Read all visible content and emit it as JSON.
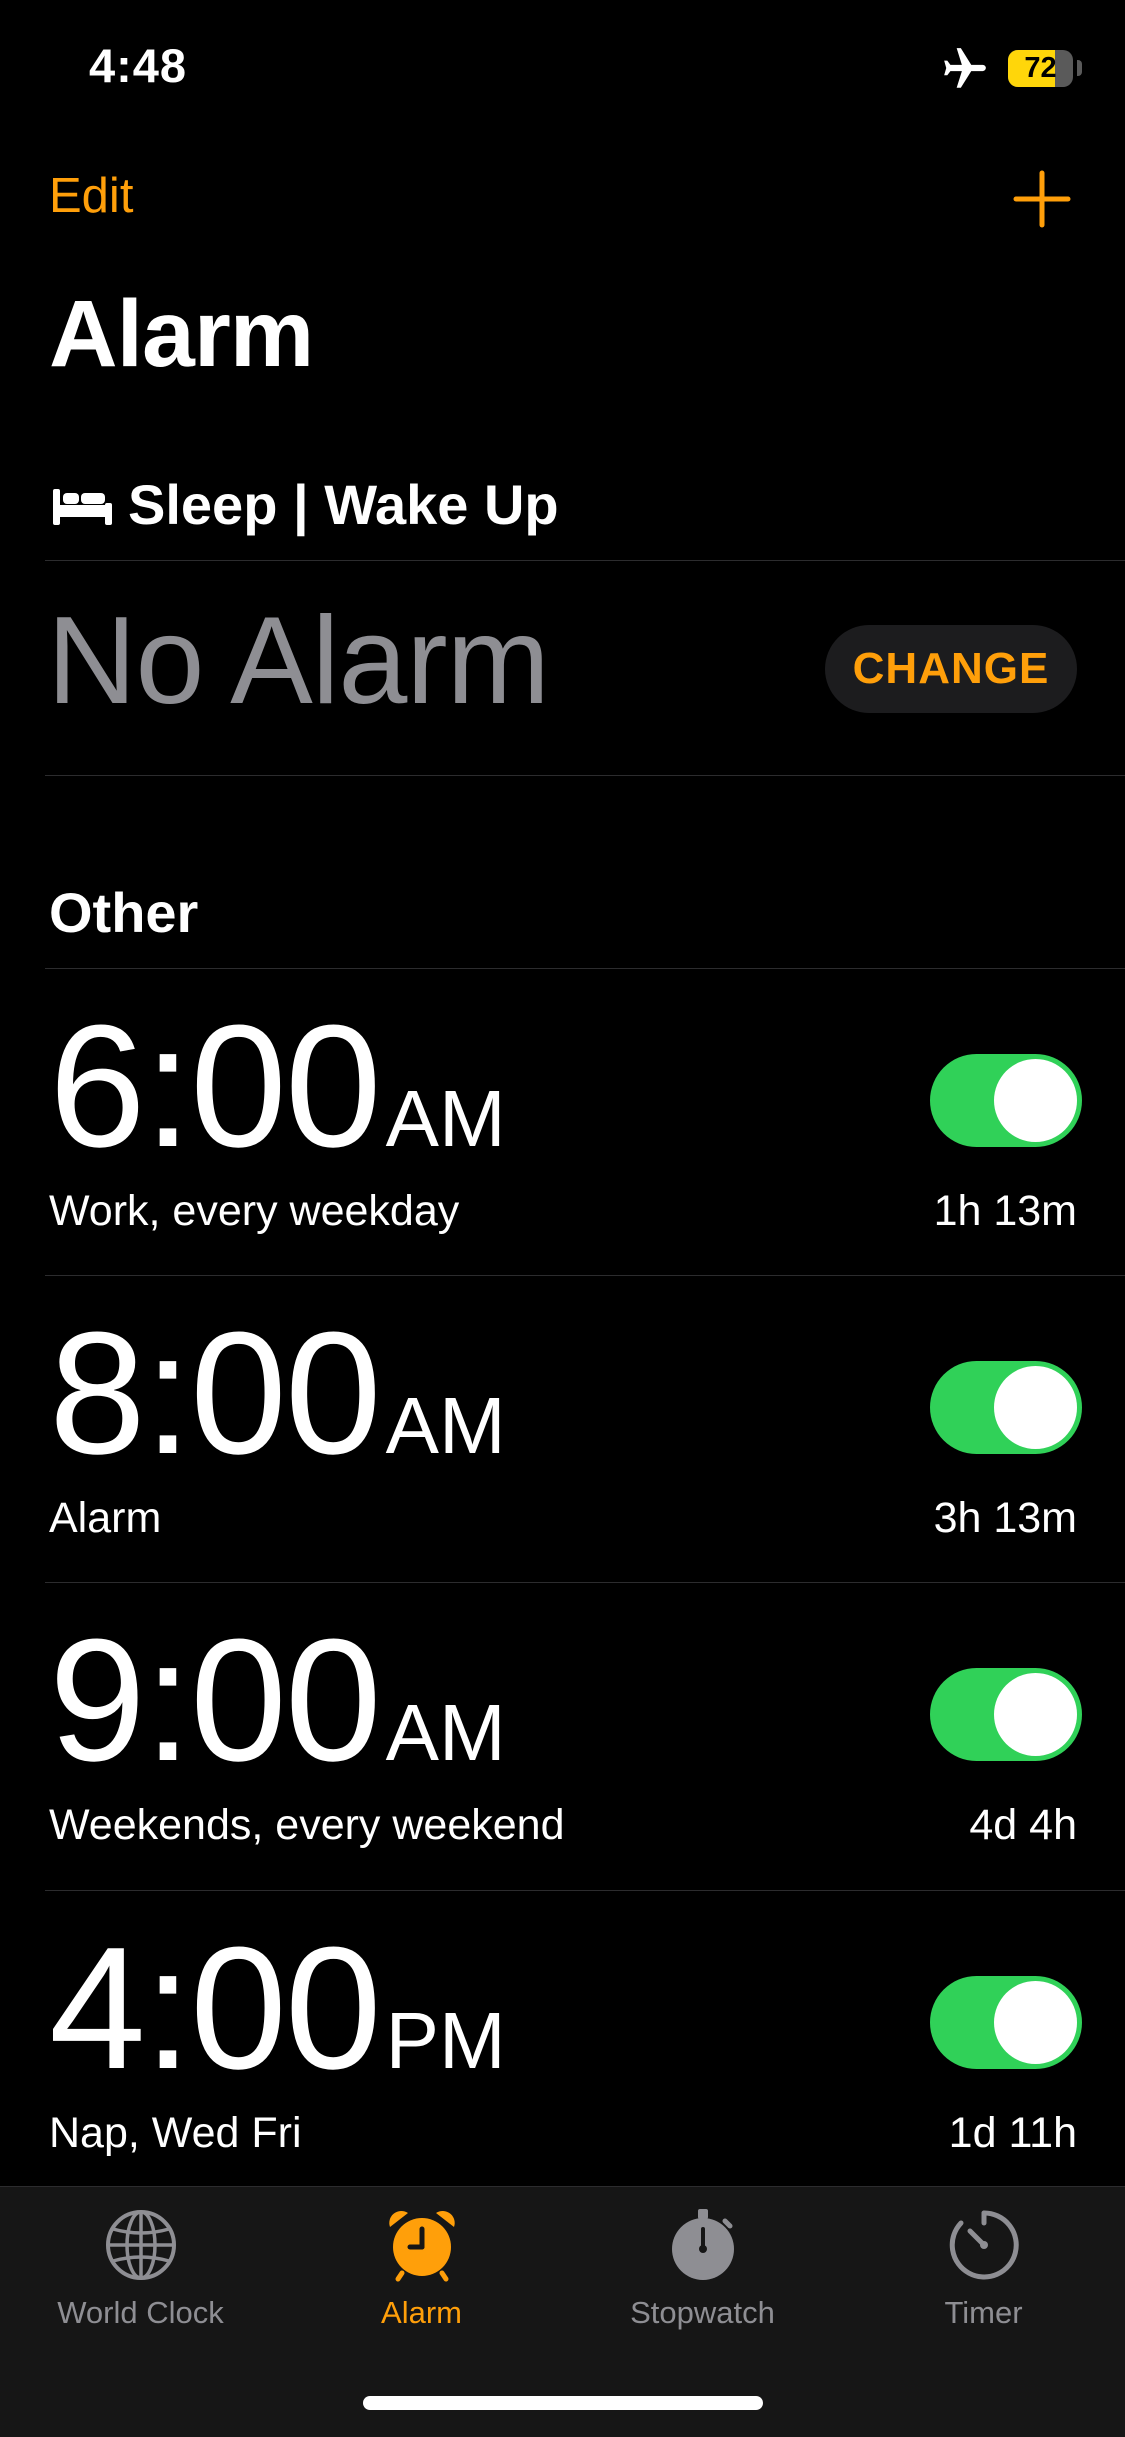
{
  "status_bar": {
    "time": "4:48",
    "battery_level": "72",
    "battery_fraction": 0.72,
    "icons": [
      "airplane-icon",
      "battery-icon"
    ]
  },
  "nav": {
    "edit_label": "Edit",
    "add_icon": "plus-icon",
    "title": "Alarm"
  },
  "sleep": {
    "title": "Sleep | Wake Up",
    "icon": "bed-icon",
    "status": "No Alarm",
    "change_label": "CHANGE"
  },
  "other": {
    "title": "Other",
    "alarms": [
      {
        "time": "6:00",
        "period": "AM",
        "label": "Work, every weekday",
        "remaining": "1h 13m",
        "enabled": true
      },
      {
        "time": "8:00",
        "period": "AM",
        "label": "Alarm",
        "remaining": "3h 13m",
        "enabled": true
      },
      {
        "time": "9:00",
        "period": "AM",
        "label": "Weekends, every weekend",
        "remaining": "4d 4h",
        "enabled": true
      },
      {
        "time": "4:00",
        "period": "PM",
        "label": "Nap, Wed Fri",
        "remaining": "1d 11h",
        "enabled": true
      }
    ]
  },
  "tabs": [
    {
      "label": "World Clock",
      "icon": "globe-icon",
      "active": false
    },
    {
      "label": "Alarm",
      "icon": "alarm-clock-icon",
      "active": true
    },
    {
      "label": "Stopwatch",
      "icon": "stopwatch-icon",
      "active": false
    },
    {
      "label": "Timer",
      "icon": "timer-icon",
      "active": false
    }
  ],
  "colors": {
    "accent": "#ff9f0a",
    "toggle_on": "#30d158",
    "secondary_text": "#8e8e93",
    "background": "#000000"
  }
}
